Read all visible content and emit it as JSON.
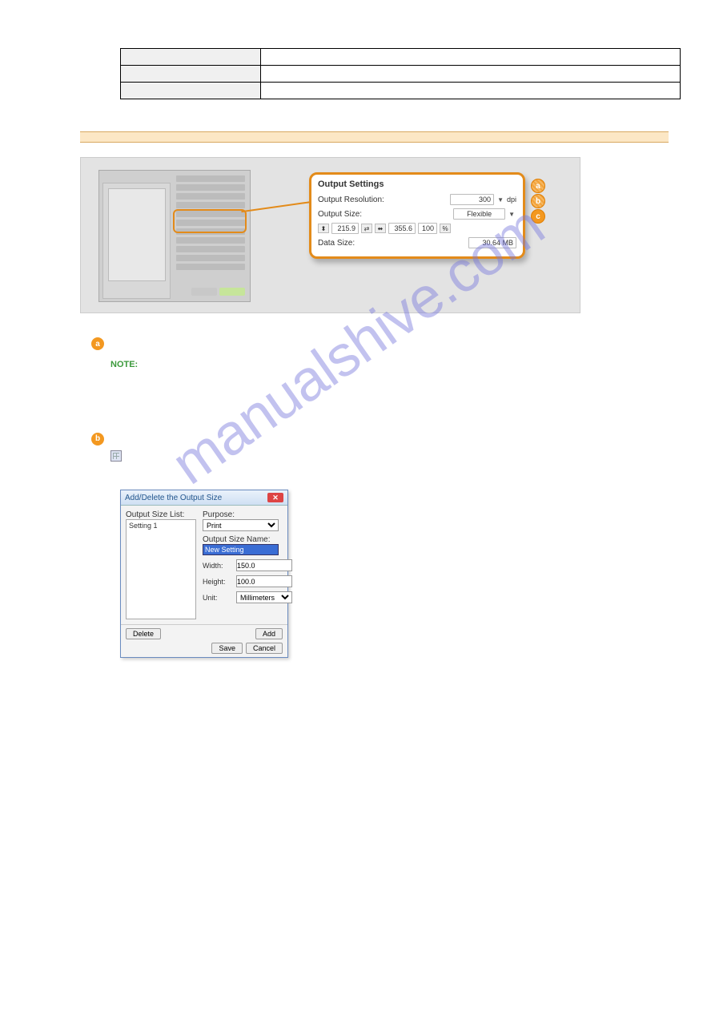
{
  "watermark": "manualshive.com",
  "table": {
    "rows": [
      {
        "key": "",
        "val": ""
      },
      {
        "key": "",
        "val": ""
      },
      {
        "key": "",
        "val": ""
      }
    ]
  },
  "section": {
    "title": "",
    "desc": ""
  },
  "callout": {
    "title": "Output Settings",
    "res_label": "Output Resolution:",
    "res_value": "300",
    "res_unit": "dpi",
    "size_label": "Output Size:",
    "size_value": "Flexible",
    "w": "215.9",
    "h": "355.6",
    "pct": "100",
    "data_label": "Data Size:",
    "data_value": "30.64 MB"
  },
  "markers": {
    "a": "a",
    "b": "b",
    "c": "c"
  },
  "body": {
    "a_head": "",
    "a_desc": "",
    "note_label": "NOTE:",
    "note_text": "",
    "b_head": "",
    "b_desc": ""
  },
  "dialog": {
    "title": "Add/Delete the Output Size",
    "list_label": "Output Size List:",
    "list_item": "Setting 1",
    "purpose_label": "Purpose:",
    "purpose_value": "Print",
    "osn_label": "Output Size Name:",
    "osn_value": "New Setting",
    "width_label": "Width:",
    "width_value": "150.0",
    "height_label": "Height:",
    "height_value": "100.0",
    "unit_label": "Unit:",
    "unit_value": "Millimeters",
    "delete": "Delete",
    "add": "Add",
    "save": "Save",
    "cancel": "Cancel"
  }
}
